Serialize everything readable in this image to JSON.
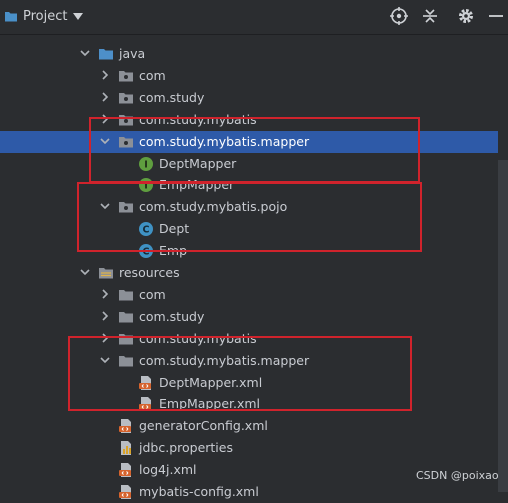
{
  "toolbar": {
    "title": "Project",
    "icons": [
      "folder-icon",
      "dropdown-arrow-icon",
      "locate-icon",
      "collapse-icon",
      "gear-icon",
      "minimize-icon"
    ]
  },
  "tree": [
    {
      "label": "java",
      "kind": "source-folder",
      "expanded": true
    },
    {
      "label": "com",
      "kind": "package",
      "expanded": false
    },
    {
      "label": "com.study",
      "kind": "package",
      "expanded": false
    },
    {
      "label": "com.study.mybatis",
      "kind": "package",
      "expanded": false
    },
    {
      "label": "com.study.mybatis.mapper",
      "kind": "package",
      "expanded": true,
      "selected": true
    },
    {
      "label": "DeptMapper",
      "kind": "interface"
    },
    {
      "label": "EmpMapper",
      "kind": "interface"
    },
    {
      "label": "com.study.mybatis.pojo",
      "kind": "package",
      "expanded": true
    },
    {
      "label": "Dept",
      "kind": "class"
    },
    {
      "label": "Emp",
      "kind": "class"
    },
    {
      "label": "resources",
      "kind": "resources-folder",
      "expanded": true
    },
    {
      "label": "com",
      "kind": "folder",
      "expanded": false
    },
    {
      "label": "com.study",
      "kind": "folder",
      "expanded": false
    },
    {
      "label": "com.study.mybatis",
      "kind": "folder",
      "expanded": false
    },
    {
      "label": "com.study.mybatis.mapper",
      "kind": "folder",
      "expanded": true
    },
    {
      "label": "DeptMapper.xml",
      "kind": "xml"
    },
    {
      "label": "EmpMapper.xml",
      "kind": "xml"
    },
    {
      "label": "generatorConfig.xml",
      "kind": "xml"
    },
    {
      "label": "jdbc.properties",
      "kind": "properties"
    },
    {
      "label": "log4j.xml",
      "kind": "xml"
    },
    {
      "label": "mybatis-config.xml",
      "kind": "xml"
    }
  ],
  "watermark": "CSDN @poixao"
}
